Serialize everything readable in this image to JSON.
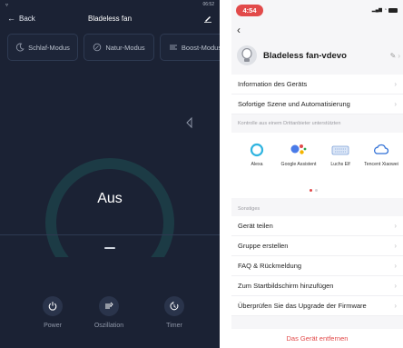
{
  "left": {
    "status_time": "06:52",
    "back_label": "Back",
    "title": "Bladeless fan",
    "modes": [
      {
        "label": "Schlaf-Modus",
        "icon": "moon-icon"
      },
      {
        "label": "Natur-Modus",
        "icon": "leaf-icon"
      },
      {
        "label": "Boost-Modus",
        "icon": "boost-icon"
      }
    ],
    "gauge_label": "Aus",
    "gauge_value": 0,
    "controls": [
      {
        "label": "Power",
        "icon": "power-icon"
      },
      {
        "label": "Oszillation",
        "icon": "oscillation-icon"
      },
      {
        "label": "Timer",
        "icon": "timer-icon"
      }
    ],
    "colors": {
      "background": "#1b2234",
      "gauge_track": "#1c3b45",
      "accent": "#ffffff"
    }
  },
  "right": {
    "status_time": "4:54",
    "device_name": "Bladeless fan-vdevo",
    "rows_top": [
      "Information des Geräts",
      "Sofortige Szene und Automatisierung"
    ],
    "section_third_party": "Kontrolle aus einem Drittanbieter unterstützten",
    "services": [
      {
        "label": "Alexa",
        "icon": "alexa-icon"
      },
      {
        "label": "Google Assistent",
        "icon": "google-assistant-icon"
      },
      {
        "label": "Luchs Elf",
        "icon": "keyboard-icon"
      },
      {
        "label": "Tencent Xiaowei",
        "icon": "tencent-icon"
      }
    ],
    "section_other": "Sonstiges",
    "rows_other": [
      "Gerät teilen",
      "Gruppe erstellen",
      "FAQ & Rückmeldung",
      "Zum Startbildschirm hinzufügen",
      "Überprüfen Sie das Upgrade der Firmware"
    ],
    "remove_label": "Das Gerät entfernen",
    "colors": {
      "accent": "#e24a4a",
      "background": "#f6f6f8"
    }
  }
}
